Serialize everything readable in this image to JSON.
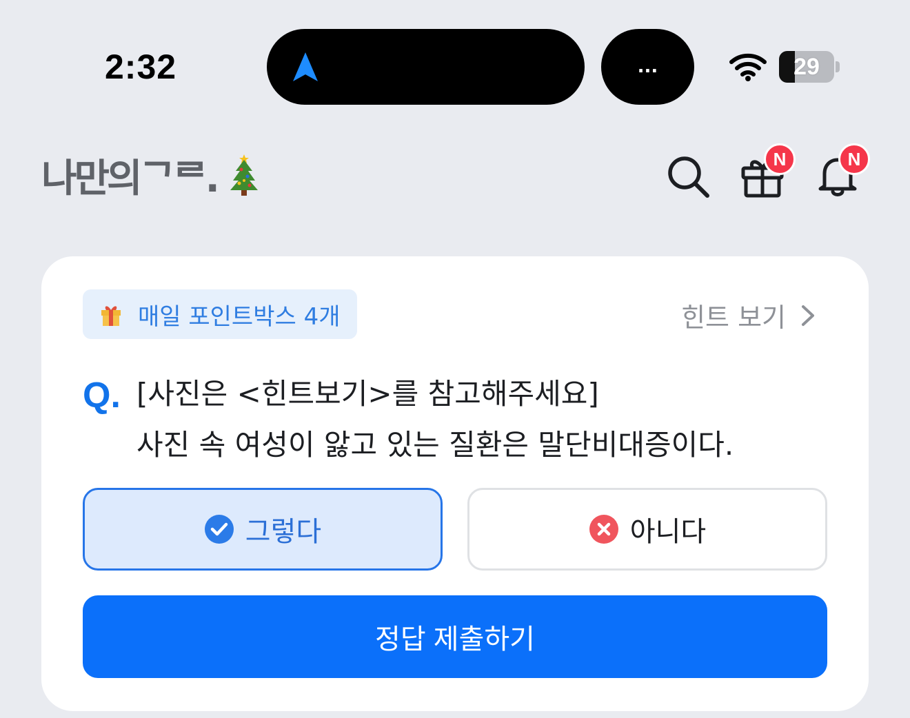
{
  "status_bar": {
    "time": "2:32",
    "island_dots": "...",
    "battery_level": "29",
    "battery_fraction": 0.29
  },
  "header": {
    "logo_text": "나만의ᄀᄅ.",
    "gift_badge": "N",
    "bell_badge": "N"
  },
  "quiz_card": {
    "points_chip": "매일 포인트박스 4개",
    "hint_link": "힌트 보기",
    "q_mark": "Q.",
    "question_line1": "[사진은 <힌트보기>를 참고해주세요]",
    "question_line2": "사진 속 여성이 앓고 있는 질환은 말단비대증이다.",
    "option_yes": "그렇다",
    "option_no": "아니다",
    "submit_label": "정답 제출하기"
  },
  "colors": {
    "accent": "#0b70fa",
    "badge": "#f5364a",
    "selected_border": "#2675e8",
    "no_icon": "#f0555d"
  }
}
